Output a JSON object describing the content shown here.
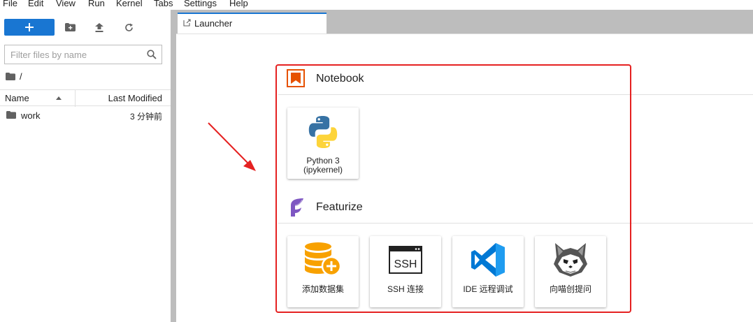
{
  "menu": [
    "File",
    "Edit",
    "View",
    "Run",
    "Kernel",
    "Tabs",
    "Settings",
    "Help"
  ],
  "filebrowser": {
    "filter_placeholder": "Filter files by name",
    "breadcrumb": "/",
    "columns": {
      "name": "Name",
      "modified": "Last Modified"
    },
    "files": [
      {
        "name": "work",
        "modified": "3 分钟前",
        "type": "folder"
      }
    ]
  },
  "tabs": [
    {
      "label": "Launcher"
    }
  ],
  "launcher": {
    "notebook_title": "Notebook",
    "featurize_title": "Featurize",
    "notebook_cards": [
      {
        "line1": "Python 3",
        "line2": "(ipykernel)",
        "icon": "python-icon"
      }
    ],
    "featurize_cards": [
      {
        "label": "添加数据集",
        "icon": "database-add-icon"
      },
      {
        "label": "SSH 连接",
        "icon": "ssh-terminal-icon"
      },
      {
        "label": "IDE 远程调试",
        "icon": "vscode-icon"
      },
      {
        "label": "向喵创提问",
        "icon": "cat-mascot-icon"
      }
    ]
  },
  "colors": {
    "accent": "#1976d2",
    "highlight": "#e52121",
    "notebook_icon": "#e65100"
  }
}
